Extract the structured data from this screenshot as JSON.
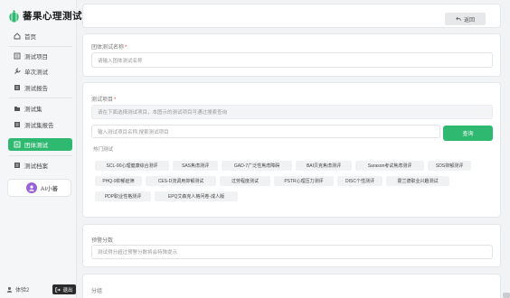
{
  "app": {
    "title": "蕃果心理测试"
  },
  "sidebar": {
    "items": [
      {
        "label": "首页",
        "icon": "home-icon",
        "active": false
      },
      {
        "label": "测试项目",
        "icon": "document-icon",
        "active": false
      },
      {
        "label": "单次测试",
        "icon": "wrench-icon",
        "active": false
      },
      {
        "label": "测试报告",
        "icon": "report-icon",
        "active": false
      },
      {
        "label": "测试集",
        "icon": "folder-icon",
        "active": false
      },
      {
        "label": "测试集报告",
        "icon": "report-icon",
        "active": false
      },
      {
        "label": "团体测试",
        "icon": "group-icon",
        "active": true
      },
      {
        "label": "测试档案",
        "icon": "archive-icon",
        "active": false
      }
    ],
    "ai_label": "AI小蕃",
    "user_name": "体验2",
    "logout_label": "退出"
  },
  "header": {
    "back_label": "返回"
  },
  "form": {
    "name_label": "团体测试名称",
    "name_placeholder": "请输入团体测试名称",
    "project_label": "测试项目",
    "project_hint": "请在下面选择测试项目，本图示的测试项目可通过搜索查询",
    "search_placeholder": "输入测试项目名称,搜索测试项目",
    "search_label": "查询",
    "hot_label": "热门测试",
    "hot_tests": [
      "SCL-90心理健康综合测评",
      "SAS焦虑测评",
      "GAD-7广泛性焦虑障碍",
      "BAI贝克焦虑测评",
      "Sarason考试焦虑测评",
      "SDS抑郁测评",
      "PHQ-9抑郁症筛",
      "CES-D流调用抑郁测试",
      "过劳程度测试",
      "PSTR心理压力测评",
      "DISC个性测评",
      "霍兰德职业兴趣测试",
      "PDP职业性格测评",
      "EPQ艾森克人格问卷-成人版"
    ],
    "hint_label": "预警分数",
    "hint_placeholder": "测试得分超过预警分数将会特殊提示",
    "group_label": "分组"
  },
  "colors": {
    "accent": "#2fb870",
    "dark": "#2b2b2b",
    "avatar": "#9a63d8"
  }
}
